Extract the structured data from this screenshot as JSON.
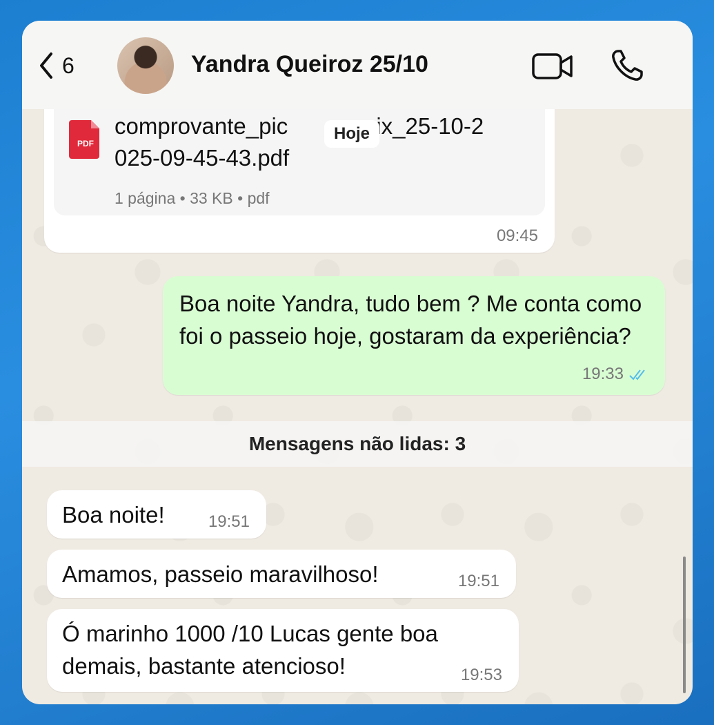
{
  "header": {
    "back_count": "6",
    "contact_name": "Yandra Queiroz 25/10"
  },
  "document_message": {
    "file_name": "comprovante_pic​ix_25-10-2025-09-45-43.pdf",
    "file_name_line1": "comprovante_pic",
    "file_name_line1b": "ix_25-10-2",
    "file_name_line2": "025-09-45-43.pdf",
    "meta": "1 página • 33 KB • pdf",
    "time": "09:45",
    "date_chip": "Hoje",
    "icon_label": "PDF"
  },
  "outgoing_message": {
    "text": "Boa noite Yandra, tudo bem ? Me conta como foi o passeio hoje, gostaram da experiência?",
    "time": "19:33"
  },
  "unread_divider": "Mensagens não lidas: 3",
  "incoming_messages": [
    {
      "text": "Boa noite!",
      "time": "19:51"
    },
    {
      "text": "Amamos, passeio maravilhoso!",
      "time": "19:51"
    },
    {
      "text": "Ó marinho 1000 /10 Lucas gente boa demais, bastante atencioso!",
      "time": "19:53"
    }
  ],
  "colors": {
    "outgoing_bubble": "#d9fdd3",
    "incoming_bubble": "#ffffff",
    "chat_background": "#efeae2",
    "read_ticks": "#53bdeb",
    "pdf_red": "#e0293a"
  }
}
